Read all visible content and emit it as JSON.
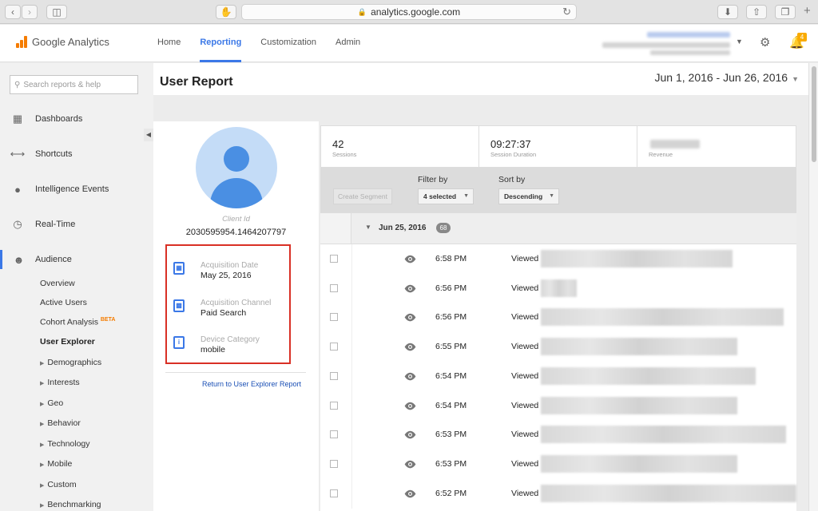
{
  "browser": {
    "url": "analytics.google.com"
  },
  "header": {
    "app_name": "Google Analytics",
    "tabs": [
      {
        "label": "Home"
      },
      {
        "label": "Reporting"
      },
      {
        "label": "Customization"
      },
      {
        "label": "Admin"
      }
    ],
    "active_tab": "Reporting",
    "notification_count": "4"
  },
  "sidebar": {
    "search_placeholder": "Search reports & help",
    "main_items": [
      {
        "label": "Dashboards",
        "icon": "grid-icon"
      },
      {
        "label": "Shortcuts",
        "icon": "shortcut-arrows-icon"
      },
      {
        "label": "Intelligence Events",
        "icon": "lightbulb-icon"
      },
      {
        "label": "Real-Time",
        "icon": "clock-icon"
      },
      {
        "label": "Audience",
        "icon": "people-icon"
      }
    ],
    "audience_sub": {
      "overview": "Overview",
      "active_users": "Active Users",
      "cohort": "Cohort Analysis",
      "cohort_badge": "BETA",
      "user_explorer": "User Explorer",
      "demographics": "Demographics",
      "interests": "Interests",
      "geo": "Geo",
      "behavior": "Behavior",
      "technology": "Technology",
      "mobile": "Mobile",
      "custom": "Custom",
      "benchmarking": "Benchmarking"
    }
  },
  "page": {
    "title": "User Report",
    "date_range": "Jun 1, 2016 - Jun 26, 2016"
  },
  "profile": {
    "client_id_label": "Client Id",
    "client_id": "2030595954.1464207797",
    "acquisition_date_label": "Acquisition Date",
    "acquisition_date": "May 25, 2016",
    "acquisition_channel_label": "Acquisition Channel",
    "acquisition_channel": "Paid Search",
    "device_category_label": "Device Category",
    "device_category": "mobile",
    "return_link": "Return to User Explorer Report"
  },
  "stats": {
    "sessions_value": "42",
    "sessions_label": "Sessions",
    "duration_value": "09:27:37",
    "duration_label": "Session Duration",
    "revenue_label": "Revenue"
  },
  "toolbar": {
    "create_segment": "Create Segment",
    "filter_label": "Filter by",
    "filter_value": "4 selected",
    "sort_label": "Sort by",
    "sort_value": "Descending"
  },
  "activity": {
    "group_date": "Jun 25, 2016",
    "group_count": "68",
    "rows": [
      {
        "time": "6:58 PM",
        "action": "Viewed",
        "redact_frac": 0.75
      },
      {
        "time": "6:56 PM",
        "action": "Viewed",
        "redact_frac": 0.14
      },
      {
        "time": "6:56 PM",
        "action": "Viewed",
        "redact_frac": 0.95
      },
      {
        "time": "6:55 PM",
        "action": "Viewed",
        "redact_frac": 0.77
      },
      {
        "time": "6:54 PM",
        "action": "Viewed",
        "redact_frac": 0.84
      },
      {
        "time": "6:54 PM",
        "action": "Viewed",
        "redact_frac": 0.77
      },
      {
        "time": "6:53 PM",
        "action": "Viewed",
        "redact_frac": 0.96
      },
      {
        "time": "6:53 PM",
        "action": "Viewed",
        "redact_frac": 0.77
      },
      {
        "time": "6:52 PM",
        "action": "Viewed",
        "redact_frac": 1.0
      }
    ]
  },
  "colors": {
    "accent": "#3b78e7",
    "highlight_box": "#d93025",
    "badge": "#f9ab00"
  }
}
